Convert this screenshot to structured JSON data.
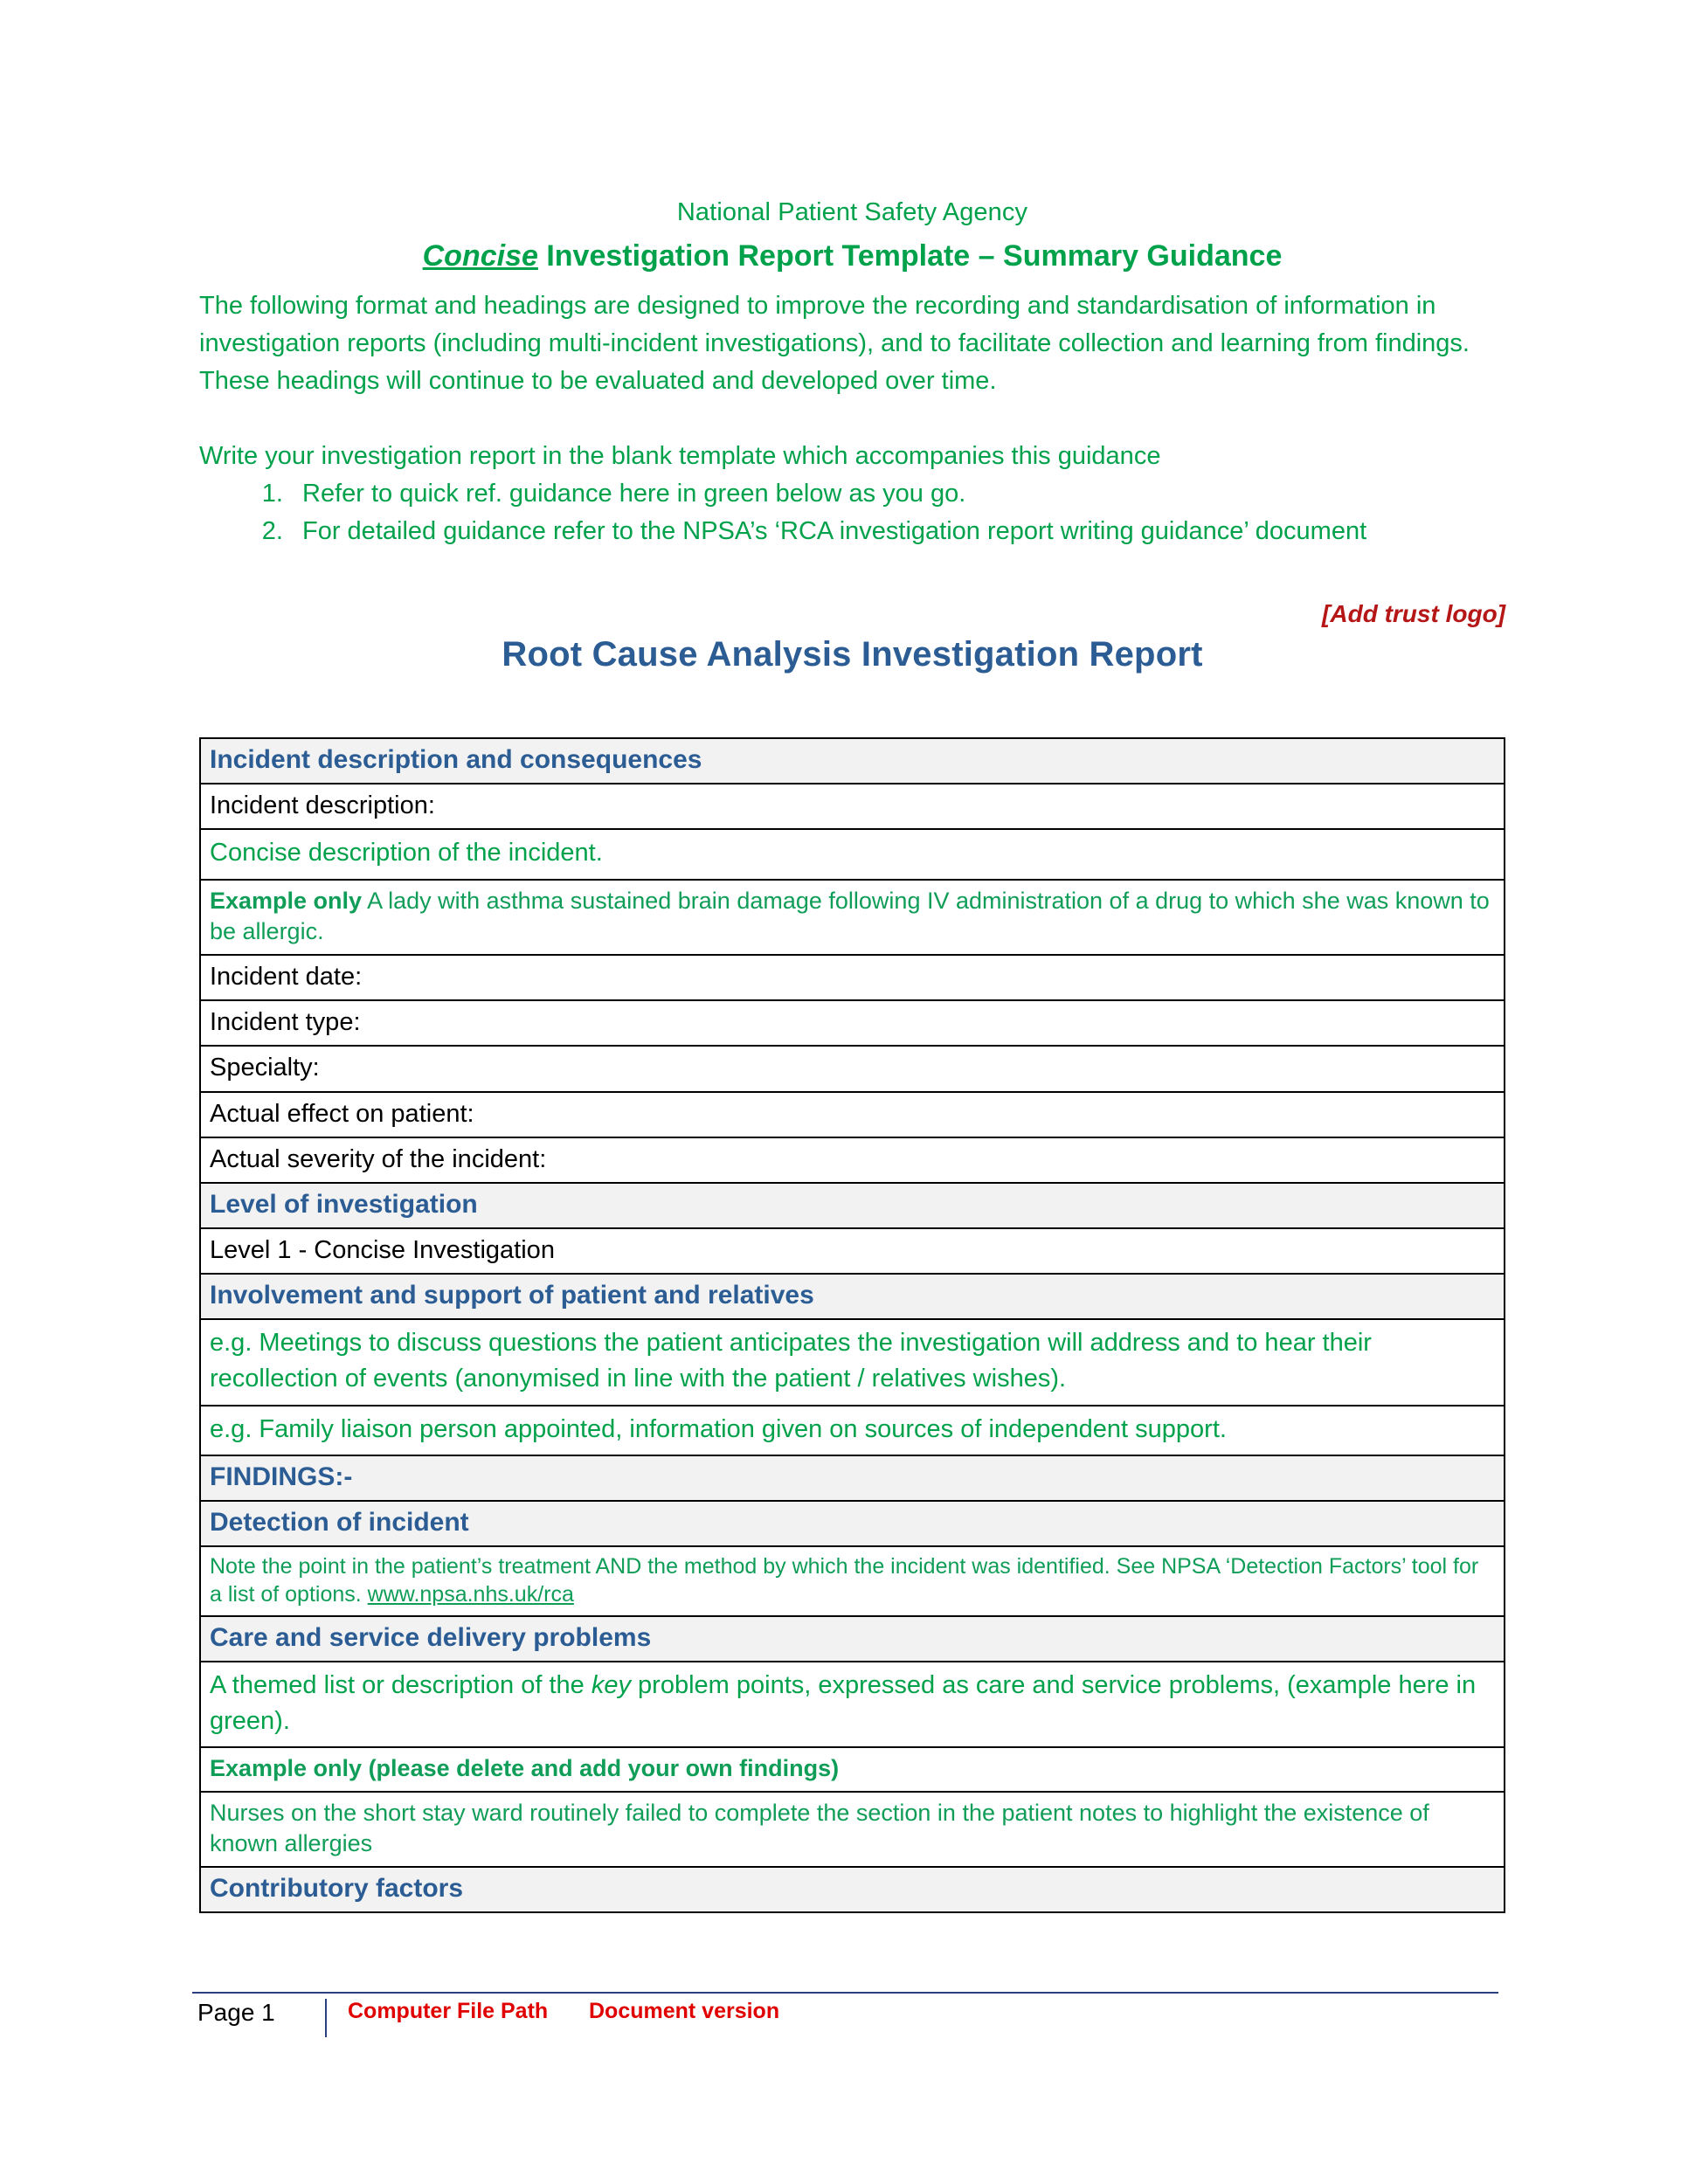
{
  "guidance": {
    "organisation": "National Patient Safety Agency",
    "subtitle_emphasis": "Concise",
    "subtitle_rest": " Investigation Report Template – Summary Guidance",
    "intro_paragraph": "The following format and headings are designed to improve the recording and standardisation of information in investigation reports (including multi-incident investigations), and to facilitate collection and learning from findings. These headings will continue to be evaluated and developed over time.",
    "write_instruction": "Write your investigation report in the blank template which accompanies this guidance",
    "steps": [
      "Refer to quick ref. guidance here in green below as you go.",
      "For detailed guidance refer to the NPSA’s ‘RCA investigation report writing guidance’ document"
    ]
  },
  "logo_placeholder": "[Add trust logo]",
  "report_title": "Root Cause Analysis Investigation Report",
  "table": {
    "section_incident": "Incident description and consequences",
    "field_incident_description": "Incident description:",
    "guide_concise": "Concise description of the incident.",
    "example_label": "Example only",
    "example_text": " A lady with asthma sustained brain damage following IV administration of a drug to which she was known to be allergic.",
    "field_incident_date": "Incident date:",
    "field_incident_type": "Incident type:",
    "field_specialty": "Specialty:",
    "field_actual_effect": "Actual effect on patient:",
    "field_actual_severity": "Actual severity of the incident:",
    "section_level": "Level of investigation",
    "level_value": "Level  1 - Concise Investigation",
    "section_involvement": "Involvement and support of patient and relatives",
    "guide_meetings": "e.g. Meetings to discuss questions the patient anticipates the investigation will address and to hear their recollection of events (anonymised in line with the patient / relatives wishes).",
    "guide_family_liaison": "e.g. Family liaison person appointed, information given on sources of independent support.",
    "section_findings": "FINDINGS:-",
    "section_detection": "Detection of incident",
    "guide_detection_part1": "Note the point in the patient’s treatment AND the method by which the incident was identified. See NPSA ‘Detection Factors’ tool for a list of options. ",
    "guide_detection_link": "www.npsa.nhs.uk/rca",
    "section_care_problems": "Care and service delivery problems",
    "guide_themed_part1": "A themed list or description of the ",
    "guide_themed_italic": "key",
    "guide_themed_part2": " problem points, expressed as care and service problems, (example here in green).",
    "example_delete_note": "Example only (please delete and add your own findings)",
    "example_nurses": "Nurses on the short stay ward routinely failed to complete the section in the patient notes to highlight the existence of known allergies",
    "section_contributory": "Contributory factors"
  },
  "footer": {
    "page": "Page 1",
    "file_path": "Computer File Path",
    "document_version": "Document version"
  },
  "colors": {
    "green": "#00A14B",
    "green_arial": "#0F9D58",
    "blue_heading": "#2B5C93",
    "dark_red": "#B51616",
    "footer_red": "#E00000",
    "header_row_bg": "#F2F2F2",
    "footer_rule": "#2B3E7E"
  }
}
